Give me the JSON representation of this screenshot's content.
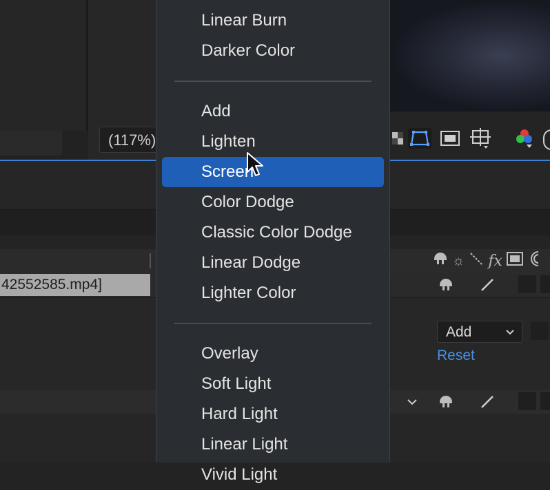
{
  "viewer": {
    "zoom_label": "(117%)"
  },
  "layer": {
    "name": "42552585.mp4]"
  },
  "effect_controls": {
    "mode_value": "Add",
    "reset_label": "Reset"
  },
  "blend_menu": {
    "selected": "Screen",
    "groups": [
      [
        "Linear Burn",
        "Darker Color"
      ],
      [
        "Add",
        "Lighten",
        "Screen",
        "Color Dodge",
        "Classic Color Dodge",
        "Linear Dodge",
        "Lighter Color"
      ],
      [
        "Overlay",
        "Soft Light",
        "Hard Light",
        "Linear Light",
        "Vivid Light"
      ]
    ]
  },
  "icons": {
    "header": [
      "shy-icon",
      "collapse-icon",
      "quality-icon",
      "fx-icon",
      "frame-blend-icon",
      "motion-blur-icon"
    ],
    "viewer": [
      "transparency-grid-icon",
      "mask-path-icon",
      "safe-area-icon",
      "grid-target-icon",
      "color-channels-icon"
    ]
  },
  "colors": {
    "selection": "#1f5fb8",
    "accent_link": "#4b8fe0",
    "menu_bg": "#2a2d31"
  }
}
